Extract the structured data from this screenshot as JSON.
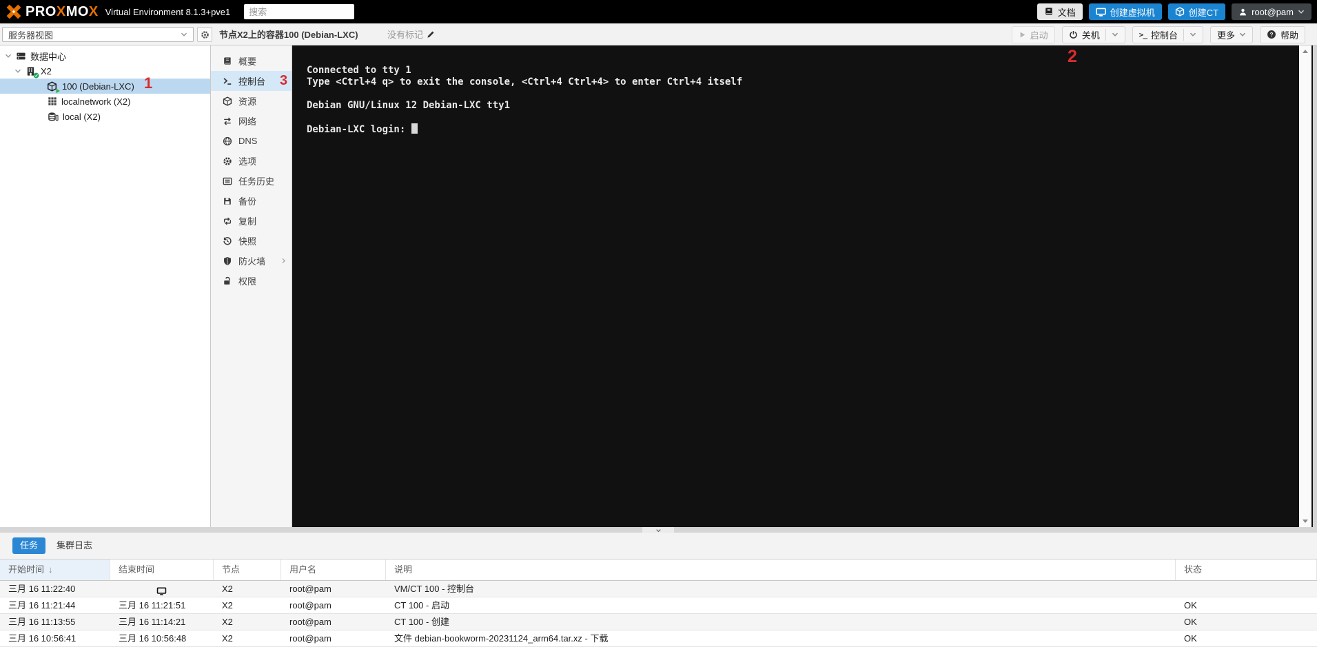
{
  "topbar": {
    "logo": {
      "p1": "PRO",
      "x1": "X",
      "p2": "MO",
      "x2": "X"
    },
    "subtitle": "Virtual Environment 8.1.3+pve1",
    "search_placeholder": "搜索",
    "docs_label": "文档",
    "create_vm_label": "创建虚拟机",
    "create_ct_label": "创建CT",
    "user_label": "root@pam"
  },
  "view_selector": {
    "value": "服务器视图"
  },
  "tree": {
    "items": [
      {
        "label": "数据中心",
        "icon": "server-icon"
      },
      {
        "label": "X2",
        "icon": "node-icon"
      },
      {
        "label": "100 (Debian-LXC)",
        "icon": "lxc-running-icon"
      },
      {
        "label": "localnetwork (X2)",
        "icon": "network-grid-icon"
      },
      {
        "label": "local (X2)",
        "icon": "storage-icon"
      }
    ]
  },
  "content_header": {
    "title": "节点X2上的容器100 (Debian-LXC)",
    "tags_label": "没有标记",
    "start_label": "启动",
    "shutdown_label": "关机",
    "console_label": "控制台",
    "more_label": "更多",
    "help_label": "帮助"
  },
  "menu": {
    "items": [
      {
        "label": "概要",
        "icon": "book-icon"
      },
      {
        "label": "控制台",
        "icon": "terminal-icon"
      },
      {
        "label": "资源",
        "icon": "cube-icon"
      },
      {
        "label": "网络",
        "icon": "exchange-icon"
      },
      {
        "label": "DNS",
        "icon": "globe-icon"
      },
      {
        "label": "选项",
        "icon": "gear-icon"
      },
      {
        "label": "任务历史",
        "icon": "list-icon"
      },
      {
        "label": "备份",
        "icon": "floppy-icon"
      },
      {
        "label": "复制",
        "icon": "retweet-icon"
      },
      {
        "label": "快照",
        "icon": "history-icon"
      },
      {
        "label": "防火墙",
        "icon": "shield-icon"
      },
      {
        "label": "权限",
        "icon": "unlock-icon"
      }
    ]
  },
  "console": {
    "lines": [
      "Connected to tty 1",
      "Type <Ctrl+4 q> to exit the console, <Ctrl+4 Ctrl+4> to enter Ctrl+4 itself",
      "",
      "Debian GNU/Linux 12 Debian-LXC tty1",
      ""
    ],
    "login_prompt": "Debian-LXC login: "
  },
  "annotations": {
    "n1": "1",
    "n2": "2",
    "n3": "3"
  },
  "tasks_panel": {
    "tabs": [
      {
        "label": "任务"
      },
      {
        "label": "集群日志"
      }
    ],
    "headers": [
      "开始时间",
      "结束时间",
      "节点",
      "用户名",
      "说明",
      "状态"
    ],
    "rows": [
      {
        "start": "三月 16 11:22:40",
        "end": "",
        "node": "X2",
        "user": "root@pam",
        "desc": "VM/CT 100 - 控制台",
        "status": ""
      },
      {
        "start": "三月 16 11:21:44",
        "end": "三月 16 11:21:51",
        "node": "X2",
        "user": "root@pam",
        "desc": "CT 100 - 启动",
        "status": "OK"
      },
      {
        "start": "三月 16 11:13:55",
        "end": "三月 16 11:14:21",
        "node": "X2",
        "user": "root@pam",
        "desc": "CT 100 - 创建",
        "status": "OK"
      },
      {
        "start": "三月 16 10:56:41",
        "end": "三月 16 10:56:48",
        "node": "X2",
        "user": "root@pam",
        "desc": "文件 debian-bookworm-20231124_arm64.tar.xz - 下载",
        "status": "OK"
      }
    ]
  },
  "colors": {
    "accent_blue": "#1b84d1",
    "tab_blue": "#2b87d3",
    "brand_orange": "#e57000",
    "annotation_red": "#d82c2c",
    "console_bg": "#111111",
    "tree_selection": "#bcd8f0",
    "menu_selection": "#d5e8f8"
  }
}
